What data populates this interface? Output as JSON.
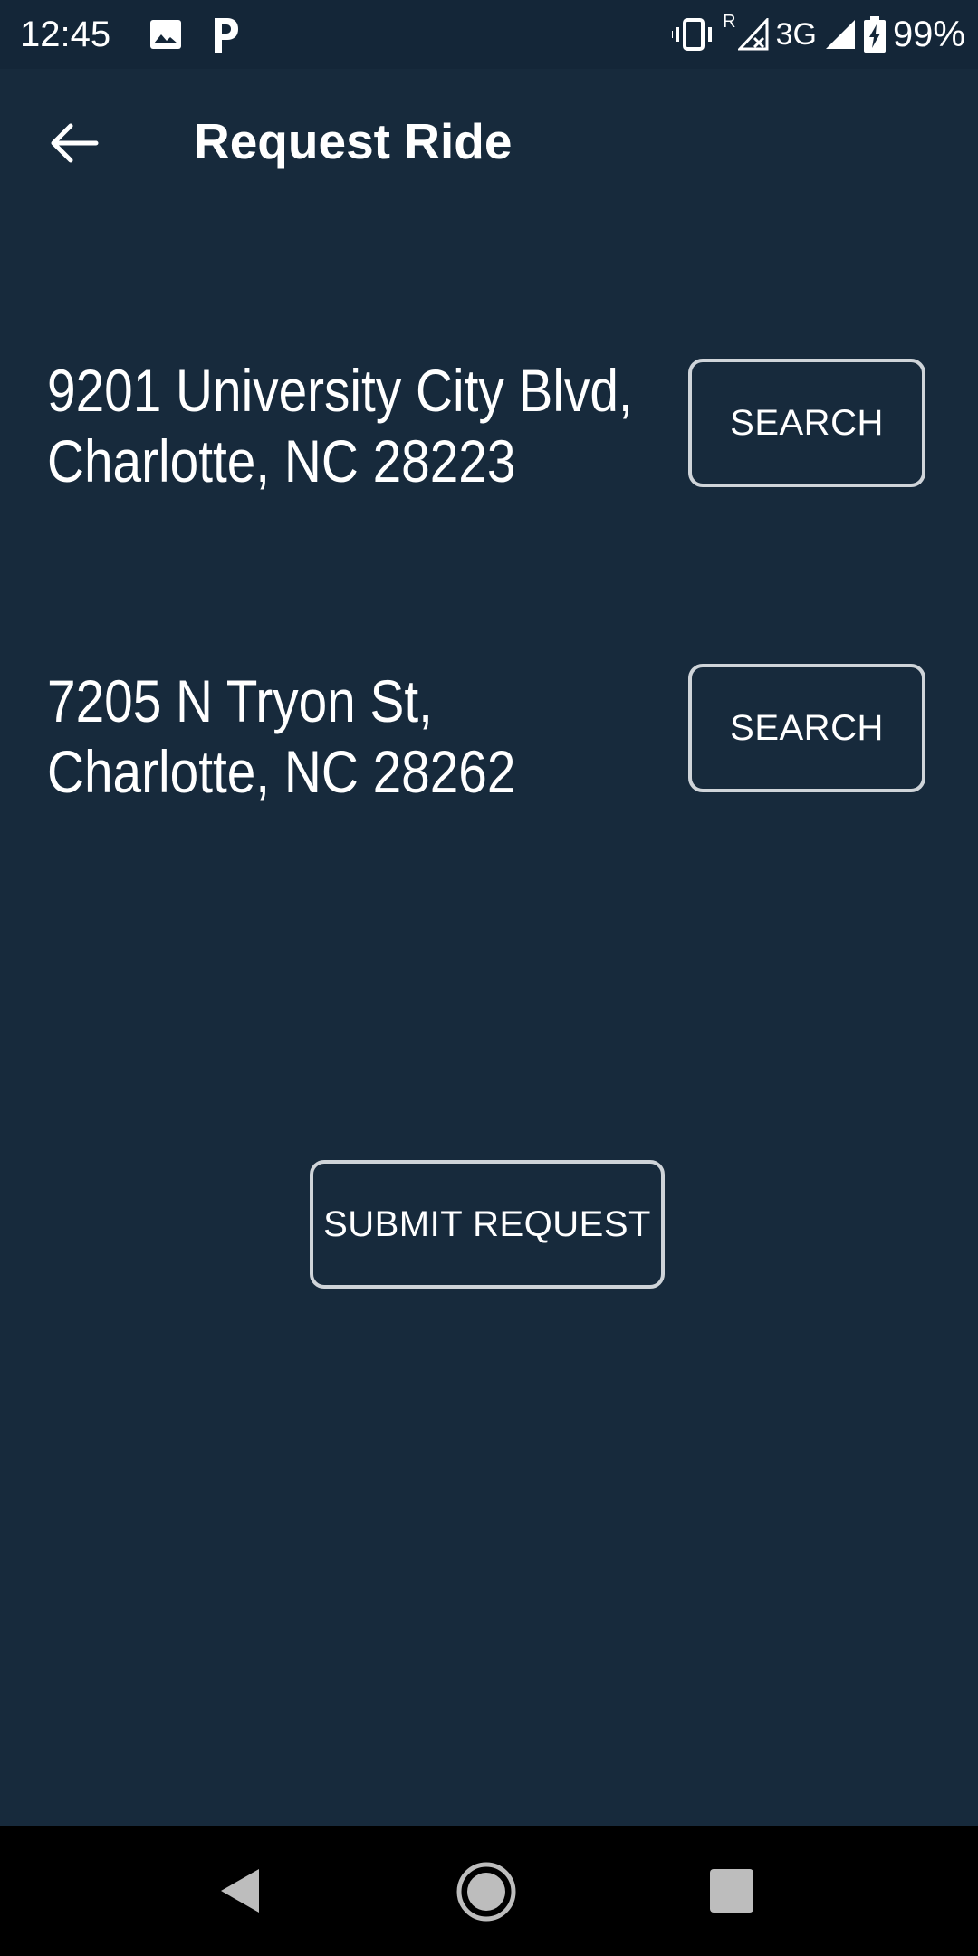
{
  "status_bar": {
    "time": "12:45",
    "left_icons": [
      "gallery-icon",
      "p-icon"
    ],
    "roaming": "R",
    "network": "3G",
    "battery": "99%",
    "right_icons": [
      "vibrate-icon",
      "signal-roaming-icon",
      "signal-icon",
      "battery-charging-icon"
    ]
  },
  "app_bar": {
    "title": "Request Ride",
    "back_icon": "arrow-back-icon"
  },
  "addresses": [
    {
      "line1": "9201 University City Blvd,",
      "line2": "Charlotte, NC 28223",
      "button_label": "SEARCH"
    },
    {
      "line1": "7205 N Tryon St,",
      "line2": "Charlotte, NC 28262",
      "button_label": "SEARCH"
    }
  ],
  "submit": {
    "label": "SUBMIT REQUEST"
  },
  "nav_bar": {
    "icons": [
      "nav-back-icon",
      "nav-home-icon",
      "nav-recents-icon"
    ]
  },
  "colors": {
    "background": "#172A3C",
    "text": "#FFFFFF",
    "button_border": "#CFD4D9",
    "nav_bar": "#000000"
  }
}
